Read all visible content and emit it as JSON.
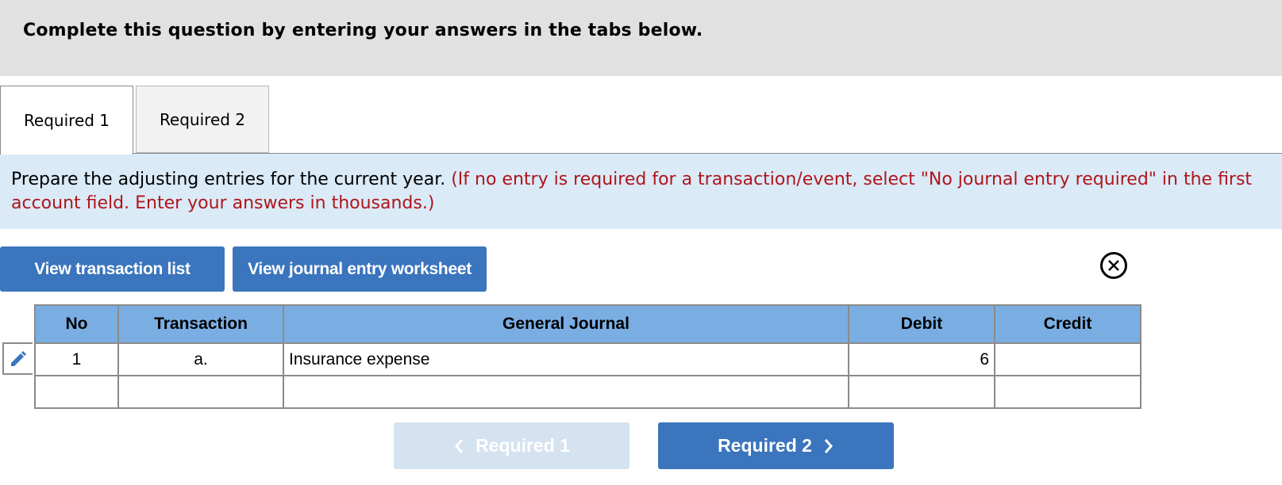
{
  "header": {
    "text": "Complete this question by entering your answers in the tabs below."
  },
  "tabs": [
    {
      "label": "Required 1",
      "active": true
    },
    {
      "label": "Required 2",
      "active": false
    }
  ],
  "instructions": {
    "main": "Prepare the adjusting entries for the current year.",
    "note": "(If no entry is required for a transaction/event, select \"No journal entry required\" in the first account field. Enter your answers in thousands.)"
  },
  "buttons": {
    "view_transaction_list": "View transaction list",
    "view_journal_worksheet": "View journal entry worksheet"
  },
  "icons": {
    "close": "close-icon",
    "edit": "pencil-icon"
  },
  "table": {
    "headers": {
      "no": "No",
      "transaction": "Transaction",
      "general_journal": "General Journal",
      "debit": "Debit",
      "credit": "Credit"
    },
    "rows": [
      {
        "no": "1",
        "transaction": "a.",
        "account": "Insurance expense",
        "debit": "6",
        "credit": ""
      },
      {
        "no": "",
        "transaction": "",
        "account": "",
        "debit": "",
        "credit": ""
      }
    ]
  },
  "navigation": {
    "prev_label": "Required 1",
    "next_label": "Required 2"
  },
  "colors": {
    "accent": "#3a75bd",
    "header_bg": "#e1e1e1",
    "instr_bg": "#daeaf7",
    "note_red": "#b0151b",
    "table_header": "#7aaee3"
  }
}
